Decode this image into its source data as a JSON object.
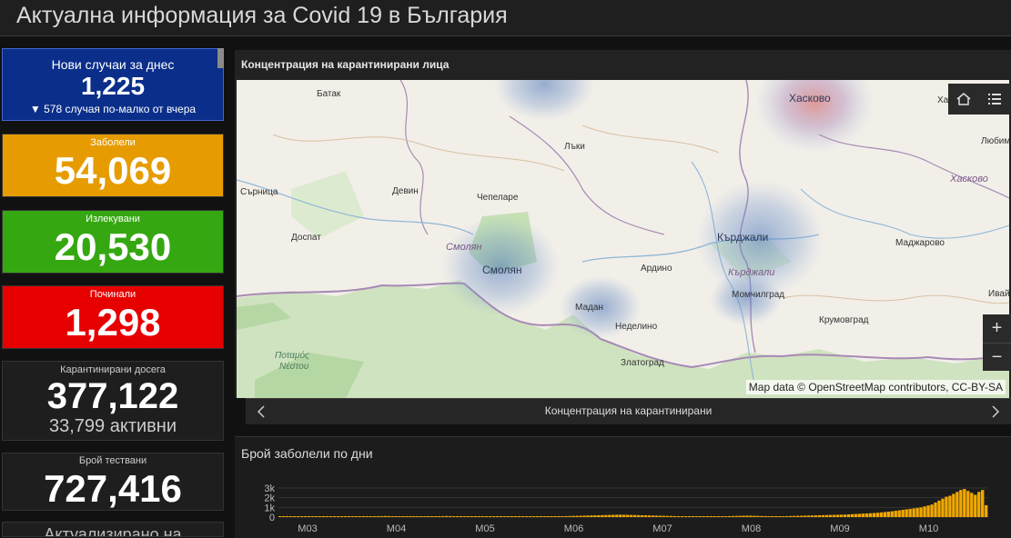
{
  "header": {
    "title": "Актуална информация за Covid 19 в България"
  },
  "cards": {
    "new": {
      "label": "Нови случаи за днес",
      "value": "1,225",
      "delta": "▼ 578 случая по-малко от вчера",
      "color": "#0a2e8a"
    },
    "cases": {
      "label": "Заболели",
      "value": "54,069",
      "color": "#e69c00"
    },
    "recovered": {
      "label": "Излекувани",
      "value": "20,530",
      "color": "#35a811"
    },
    "deaths": {
      "label": "Починали",
      "value": "1,298",
      "color": "#e60000"
    },
    "quarantine": {
      "label": "Карантинирани досега",
      "value": "377,122",
      "active": "33,799 активни"
    },
    "tests": {
      "label": "Брой тествани",
      "value": "727,416"
    },
    "next_partial": "Актуализирано на"
  },
  "map": {
    "title": "Концентрация на карантинирани лица",
    "attribution": "Map data © OpenStreetMap contributors, CC-BY-SA",
    "labels": {
      "batak": "Батак",
      "haskovo_city": "Хасково",
      "harman": "Харман",
      "lyaki": "Лъки",
      "lyubim": "Любим",
      "haskovo_prov": "Хасково",
      "sarnica": "Сърница",
      "devin": "Девин",
      "chepelare": "Чепеларе",
      "smolyan_prov": "Смолян",
      "smolyan_city": "Смолян",
      "kardzhali_city": "Кърджали",
      "kardzhali_prov": "Кърджали",
      "maydzharovo": "Маджарово",
      "dospat": "Доспат",
      "ardino": "Ардино",
      "momchilgrad": "Момчилград",
      "madan": "Мадан",
      "nedelino": "Неделино",
      "krumovgrad": "Крумовград",
      "ivaylo": "Ивай",
      "zlatograd": "Златоград",
      "potamos": "Ποταμός",
      "nestou": "Νέστου"
    },
    "zoom_in": "+",
    "zoom_out": "−"
  },
  "nav": {
    "label": "Концентрация на карантинирани"
  },
  "chart_data": {
    "type": "bar",
    "title": "Брой заболели по дни",
    "y_ticks": [
      "3k",
      "2k",
      "1k",
      "0"
    ],
    "ylim": [
      0,
      3000
    ],
    "x_ticks": [
      "M03",
      "M04",
      "M05",
      "M06",
      "M07",
      "M08",
      "M09",
      "M10"
    ],
    "color": "#f0a800",
    "values": [
      4,
      3,
      2,
      5,
      8,
      10,
      12,
      15,
      20,
      25,
      30,
      28,
      25,
      40,
      45,
      38,
      50,
      60,
      55,
      45,
      40,
      35,
      60,
      70,
      80,
      90,
      85,
      95,
      100,
      110,
      105,
      90,
      85,
      80,
      75,
      70,
      65,
      60,
      70,
      80,
      90,
      85,
      75,
      80,
      90,
      100,
      110,
      100,
      95,
      90,
      85,
      80,
      70,
      65,
      55,
      50,
      45,
      40,
      50,
      60,
      70,
      60,
      50,
      45,
      40,
      35,
      40,
      45,
      50,
      55,
      60,
      55,
      50,
      45,
      50,
      60,
      70,
      80,
      90,
      100,
      110,
      120,
      130,
      140,
      150,
      160,
      170,
      180,
      190,
      200,
      210,
      220,
      230,
      240,
      250,
      240,
      230,
      220,
      210,
      200,
      190,
      180,
      170,
      160,
      150,
      140,
      130,
      120,
      110,
      100,
      95,
      90,
      85,
      80,
      75,
      70,
      65,
      60,
      55,
      50,
      60,
      70,
      80,
      90,
      100,
      110,
      120,
      130,
      140,
      150,
      140,
      130,
      120,
      110,
      100,
      95,
      90,
      85,
      80,
      90,
      100,
      110,
      120,
      130,
      140,
      150,
      160,
      170,
      180,
      190,
      200,
      210,
      220,
      230,
      240,
      250,
      260,
      280,
      300,
      320,
      340,
      360,
      380,
      400,
      420,
      450,
      480,
      520,
      560,
      600,
      650,
      700,
      750,
      800,
      850,
      900,
      950,
      1000,
      1100,
      1200,
      1300,
      1500,
      1700,
      1900,
      2100,
      2200,
      2400,
      2600,
      2800,
      2900,
      2700,
      2500,
      2300,
      2600,
      2800,
      1225
    ]
  }
}
